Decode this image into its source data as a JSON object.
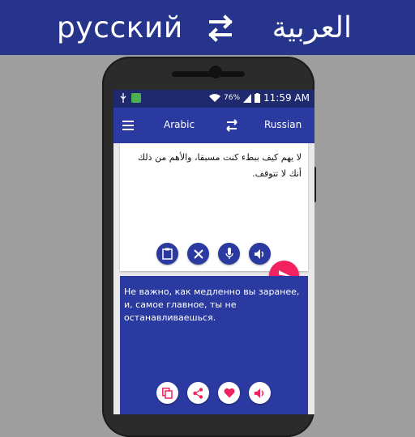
{
  "banner": {
    "left_lang": "русский",
    "right_lang": "العربية",
    "swap_icon": "swap-horiz-icon"
  },
  "statusbar": {
    "battery_percent": "76%",
    "time": "11:59 AM"
  },
  "appbar": {
    "from_lang": "Arabic",
    "to_lang": "Russian"
  },
  "source": {
    "text": "لا يهم كيف ببطء كنت مسبقا، والأهم من ذلك أنك لا تتوقف."
  },
  "result": {
    "text": "Не важно, как медленно вы заранее, и, самое главное, ты не останавливаешься."
  },
  "colors": {
    "primary": "#2b3aa0",
    "banner": "#27348b",
    "accent": "#f2215f"
  }
}
